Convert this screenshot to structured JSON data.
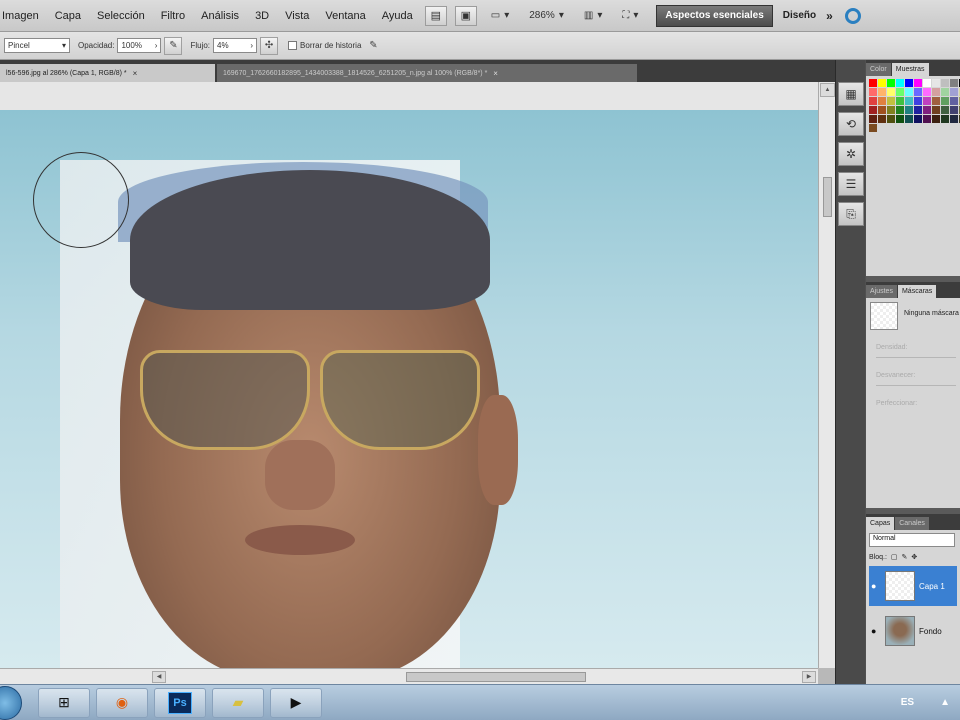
{
  "menubar": {
    "items": [
      "Imagen",
      "Capa",
      "Selección",
      "Filtro",
      "Análisis",
      "3D",
      "Vista",
      "Ventana",
      "Ayuda"
    ],
    "zoom": "286%",
    "workspace_active": "Aspectos esenciales",
    "workspace_other": "Diseño",
    "more": "»"
  },
  "options": {
    "mode_value": "Pincel",
    "opacity_label": "Opacidad:",
    "opacity_value": "100%",
    "flow_label": "Flujo:",
    "flow_value": "4%",
    "erase_history_label": "Borrar de historia"
  },
  "tabs": {
    "active": "l56-596.jpg al 286% (Capa 1, RGB/8) *",
    "inactive": "169670_1762660182895_1434003388_1814526_6251205_n.jpg al 100% (RGB/8*) *",
    "close_glyph": "×"
  },
  "panels": {
    "swatch_tabs": [
      "Color",
      "Muestras"
    ],
    "adjust_tabs": [
      "Ajustes",
      "Máscaras"
    ],
    "mask_label": "Ninguna máscara",
    "adjust_rows": [
      "Densidad:",
      "Desvanecer:",
      "Perfeccionar:"
    ],
    "layers_tabs": [
      "Capas",
      "Canales"
    ],
    "blend_mode": "Normal",
    "lock_label": "Bloq.:",
    "layers": [
      {
        "name": "Capa 1",
        "selected": true
      },
      {
        "name": "Fondo",
        "selected": false
      }
    ],
    "swatch_colors": [
      "#ff0000",
      "#ffff00",
      "#00ff00",
      "#00ffff",
      "#0000ff",
      "#ff00ff",
      "#ffffff",
      "#e6e6e6",
      "#bfbfbf",
      "#808080",
      "#000000",
      "#ff6a6a",
      "#ffb46a",
      "#ffff6a",
      "#6aff6a",
      "#6affff",
      "#6a6aff",
      "#ff6aff",
      "#d4a0a0",
      "#a0d4a0",
      "#a0a0d4",
      "#d4d4a0",
      "#e04040",
      "#e08040",
      "#c0c040",
      "#40c040",
      "#40c0c0",
      "#4040e0",
      "#c040c0",
      "#a06040",
      "#60a060",
      "#6060a0",
      "#a0a060",
      "#a02020",
      "#a05020",
      "#808020",
      "#208020",
      "#208080",
      "#2020a0",
      "#802080",
      "#704020",
      "#406040",
      "#404070",
      "#707040",
      "#602010",
      "#603010",
      "#505010",
      "#105010",
      "#105050",
      "#101060",
      "#501050",
      "#3c2010",
      "#203820",
      "#202840",
      "#403c20",
      "#7a4a20"
    ]
  },
  "taskbar": {
    "ps_label": "Ps",
    "lang": "ES"
  }
}
